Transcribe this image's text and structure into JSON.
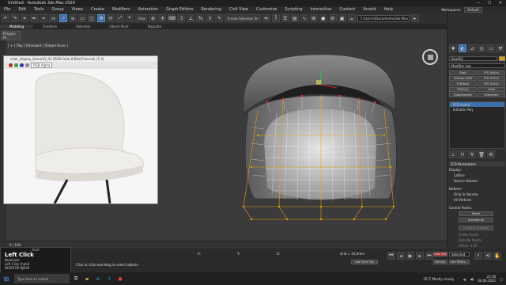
{
  "window": {
    "title": "Untitled - Autodesk 3ds Max 2020",
    "controls": [
      "—",
      "☐",
      "✕"
    ]
  },
  "menu": {
    "items": [
      "File",
      "Edit",
      "Tools",
      "Group",
      "Views",
      "Create",
      "Modifiers",
      "Animation",
      "Graph Editors",
      "Rendering",
      "Civil View",
      "Customize",
      "Scripting",
      "Interactive",
      "Content",
      "Arnold",
      "Help"
    ],
    "workspace_label": "Workspaces:",
    "workspace_value": "Default"
  },
  "toolbar": {
    "filter_value": "All",
    "view_value": "View",
    "create_selection_set": "Create Selection Se",
    "path": "C:\\Users\\\\Documents\\3ds Max 2020"
  },
  "ribbon": {
    "tabs": [
      "Modeling",
      "Freeform",
      "Selection",
      "Object Paint",
      "Populate"
    ],
    "poly_button": "Polygon M..."
  },
  "viewport": {
    "label": "[ + ] [Top ] [Standard ] [Edged Faces ]"
  },
  "viewer": {
    "title": "chair_display_Scene01_01 (RGB Color 8 Bits/Channel) (1:3)",
    "channel": "RGB Alpha"
  },
  "command_panel": {
    "object_name": "Box001",
    "modifier_list": "Modifier List",
    "buttons": [
      "Push",
      "FFD 4x4x4",
      "Unwrap UVW",
      "FFD 3x3x3",
      "FFD(box)",
      "FFD 2x2x2",
      "FFD(cyl)",
      "Shell",
      "TurboSmooth",
      "Symmetry"
    ],
    "stack": [
      "FFD 4x4x4",
      "Editable Poly"
    ],
    "ffd_section": "FFD Parameters",
    "display_label": "Display:",
    "lattice": "Lattice",
    "source_volume": "Source Volume",
    "deform_label": "Deform:",
    "only_in_volume": "Only In Volume",
    "all_vertices": "All Vertices",
    "control_points": "Control Points:",
    "reset": "Reset",
    "animate_all": "Animate All",
    "conform_to_shape": "Conform to Shape",
    "inside_points": "Inside Points",
    "outside_points": "Outside Points",
    "offset_label": "Offset: 0.05",
    "about": "About"
  },
  "timeline": {
    "frame": "0 / 100",
    "auto_key": "Auto Key",
    "selected": "Selected",
    "set_key": "Set Key",
    "key_filters": "Key Filters..."
  },
  "status": {
    "hint": "Click or click-and-drag to select objects",
    "add_time_tag": "Add Time Tag",
    "grid": "Grid = 10,0mm",
    "x": "X:",
    "y": "Y:",
    "z": "Z:"
  },
  "popup": {
    "header": "Hold",
    "title": "Left Click",
    "line1": "NumLock",
    "line2": "Left Click (hold)",
    "line3": "DESKTOP-6JEV9"
  },
  "taskbar": {
    "search_placeholder": "Type here to search",
    "weather": "25°C  Mostly cloudy",
    "time": "22:30",
    "date": "04.06.2021"
  },
  "colors": {
    "accent": "#3d6fa8",
    "ffd_lattice": "#e0a000",
    "selected_red": "#d12a2a"
  }
}
